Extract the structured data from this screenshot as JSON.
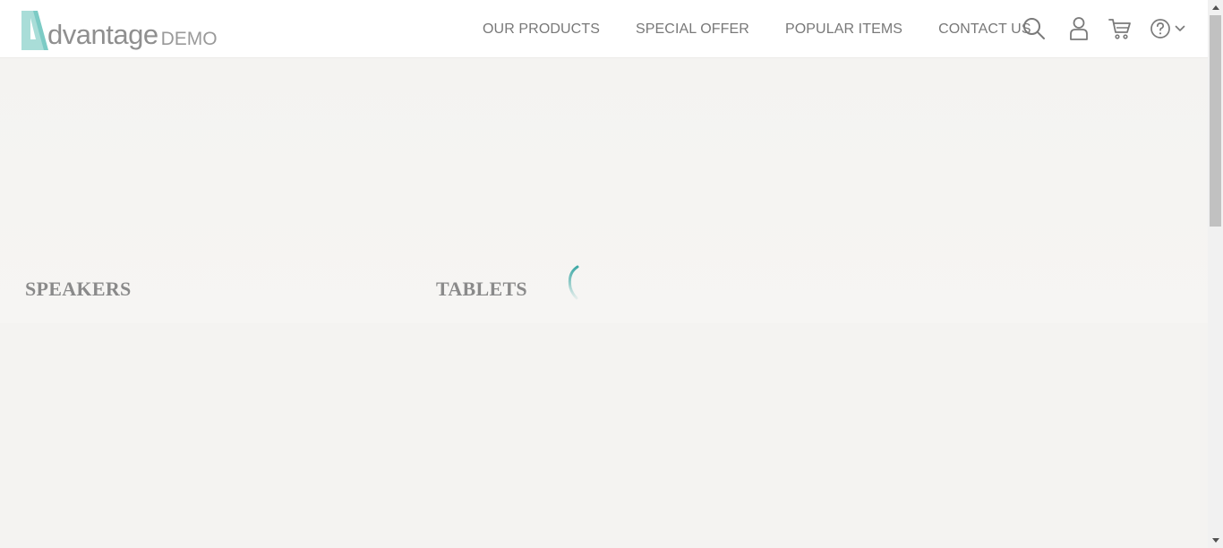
{
  "brand": {
    "logo_text": "dvantage",
    "logo_suffix": "DEMO",
    "accent_color": "#9fd8d3"
  },
  "nav": {
    "items": [
      {
        "label": "OUR PRODUCTS"
      },
      {
        "label": "SPECIAL OFFER"
      },
      {
        "label": "POPULAR ITEMS"
      },
      {
        "label": "CONTACT US"
      }
    ]
  },
  "header_icons": {
    "search": "search-icon",
    "user": "user-icon",
    "cart": "cart-icon",
    "help": "help-icon",
    "help_menu": "chevron-down-icon"
  },
  "categories": [
    {
      "label": "SPEAKERS"
    },
    {
      "label": "TABLETS"
    }
  ],
  "loader": {
    "icon": "loading-spinner-icon",
    "color": "#4fb3b0"
  }
}
